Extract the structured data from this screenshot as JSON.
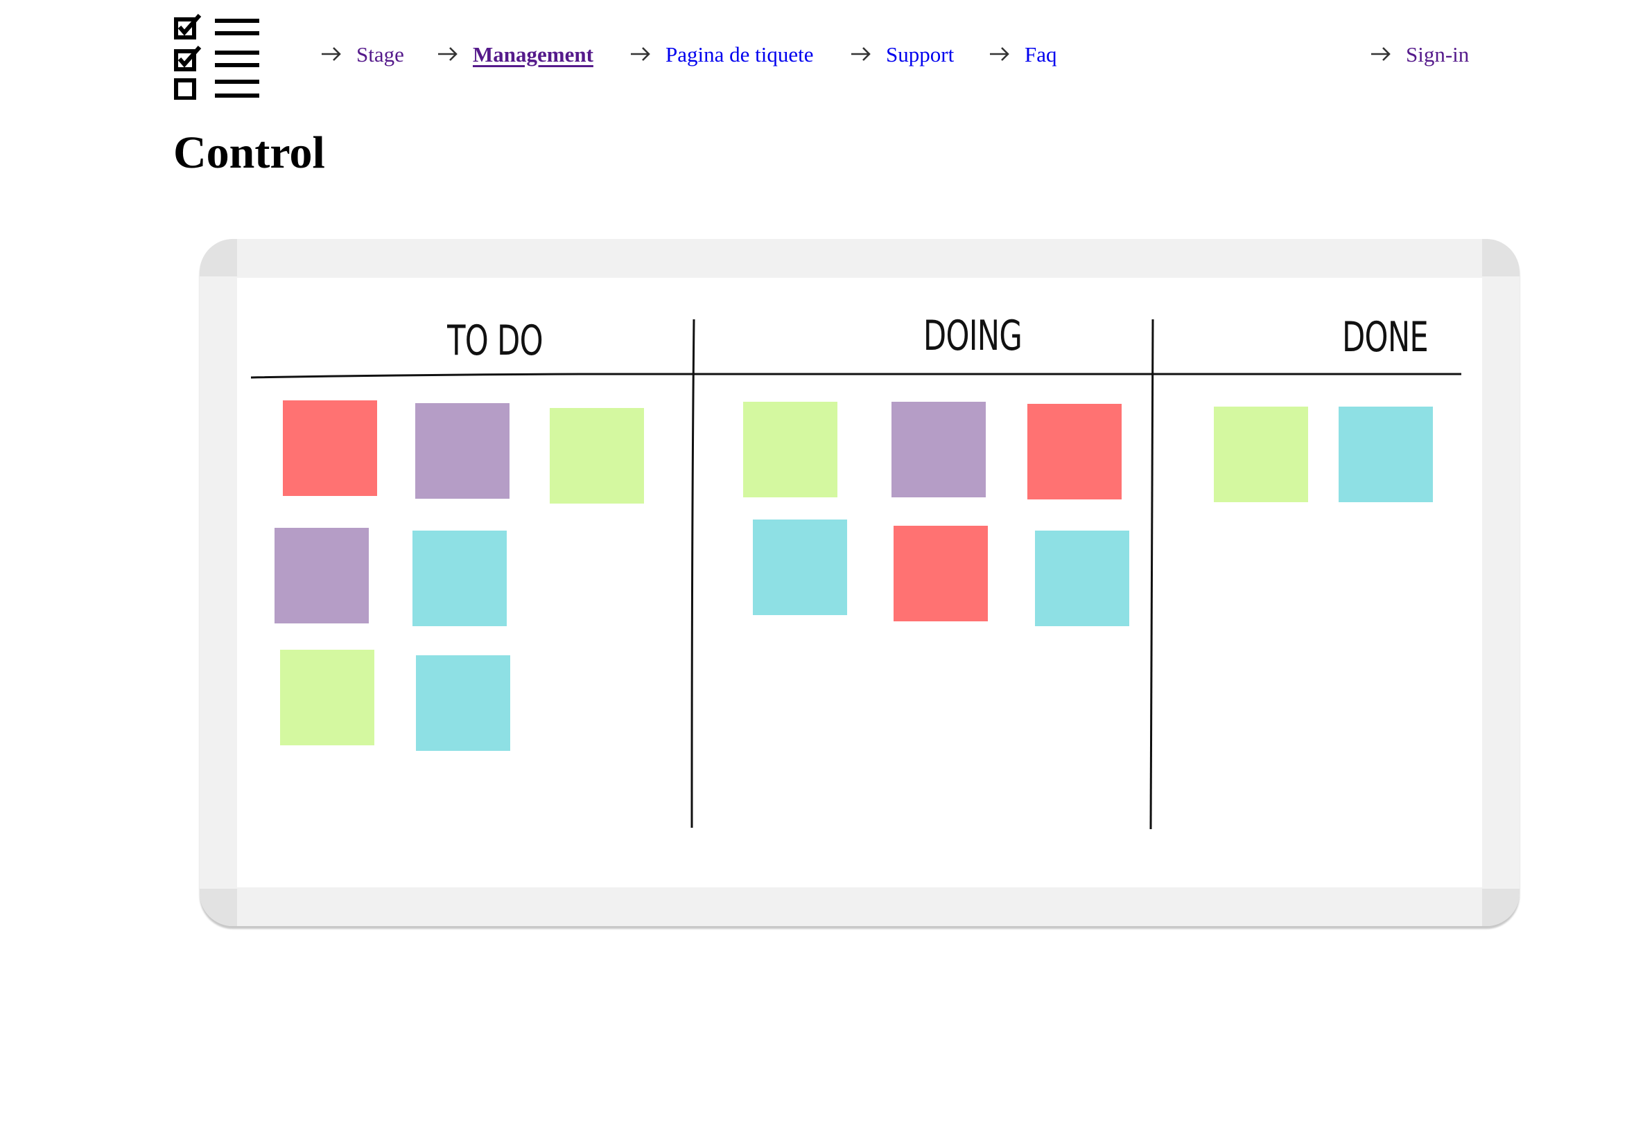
{
  "colors": {
    "red": "#ff7272",
    "purple": "#b59dc6",
    "green": "#d4f8a0",
    "cyan": "#8ee0e4",
    "visited_link": "#551a8b",
    "link": "#0000ee"
  },
  "header": {
    "logo_icon": "checklist-icon",
    "nav": [
      {
        "label": "Stage",
        "state": "visited"
      },
      {
        "label": "Management",
        "state": "active"
      },
      {
        "label": "Pagina de tiquete",
        "state": "link"
      },
      {
        "label": "Support",
        "state": "link"
      },
      {
        "label": "Faq",
        "state": "link"
      }
    ],
    "signin": {
      "label": "Sign-in",
      "state": "visited"
    }
  },
  "page": {
    "title": "Control"
  },
  "board": {
    "columns": [
      {
        "title": "TO DO",
        "notes": [
          "red",
          "purple",
          "green",
          "purple",
          "cyan",
          "green",
          "cyan"
        ]
      },
      {
        "title": "DOING",
        "notes": [
          "green",
          "purple",
          "red",
          "cyan",
          "red",
          "cyan"
        ]
      },
      {
        "title": "DONE",
        "notes": [
          "green",
          "cyan"
        ]
      }
    ]
  }
}
